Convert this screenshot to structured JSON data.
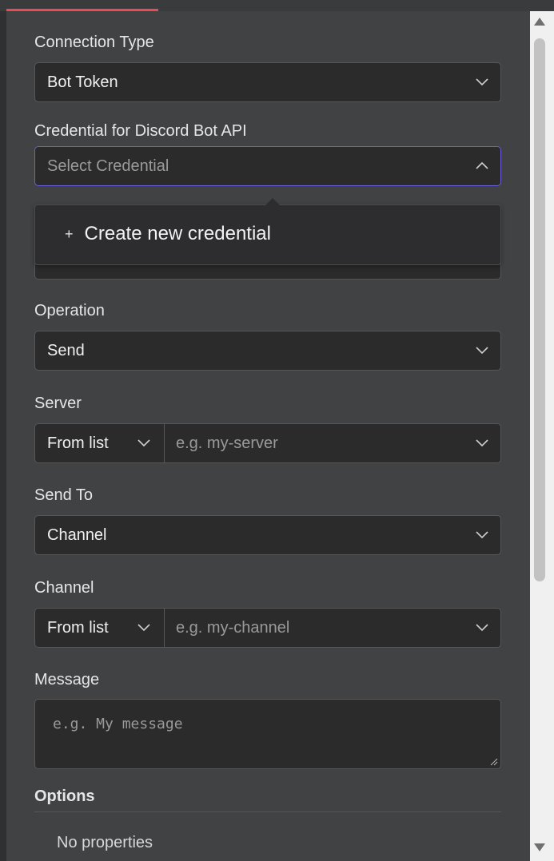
{
  "form": {
    "connection_type": {
      "label": "Connection Type",
      "value": "Bot Token"
    },
    "credential": {
      "label": "Credential for Discord Bot API",
      "placeholder": "Select Credential"
    },
    "credential_dropdown": {
      "create_label": "Create new credential",
      "plus": "+"
    },
    "operation": {
      "label": "Operation",
      "value": "Send"
    },
    "server": {
      "label": "Server",
      "mode": "From list",
      "placeholder": "e.g. my-server"
    },
    "send_to": {
      "label": "Send To",
      "value": "Channel"
    },
    "channel": {
      "label": "Channel",
      "mode": "From list",
      "placeholder": "e.g. my-channel"
    },
    "message": {
      "label": "Message",
      "placeholder": "e.g. My message"
    },
    "options": {
      "label": "Options",
      "empty_text": "No properties"
    }
  },
  "colors": {
    "accent": "#ea4b54",
    "focus_border": "#6a5fd6",
    "panel_bg": "#414244",
    "input_bg": "#2b2b2b"
  }
}
